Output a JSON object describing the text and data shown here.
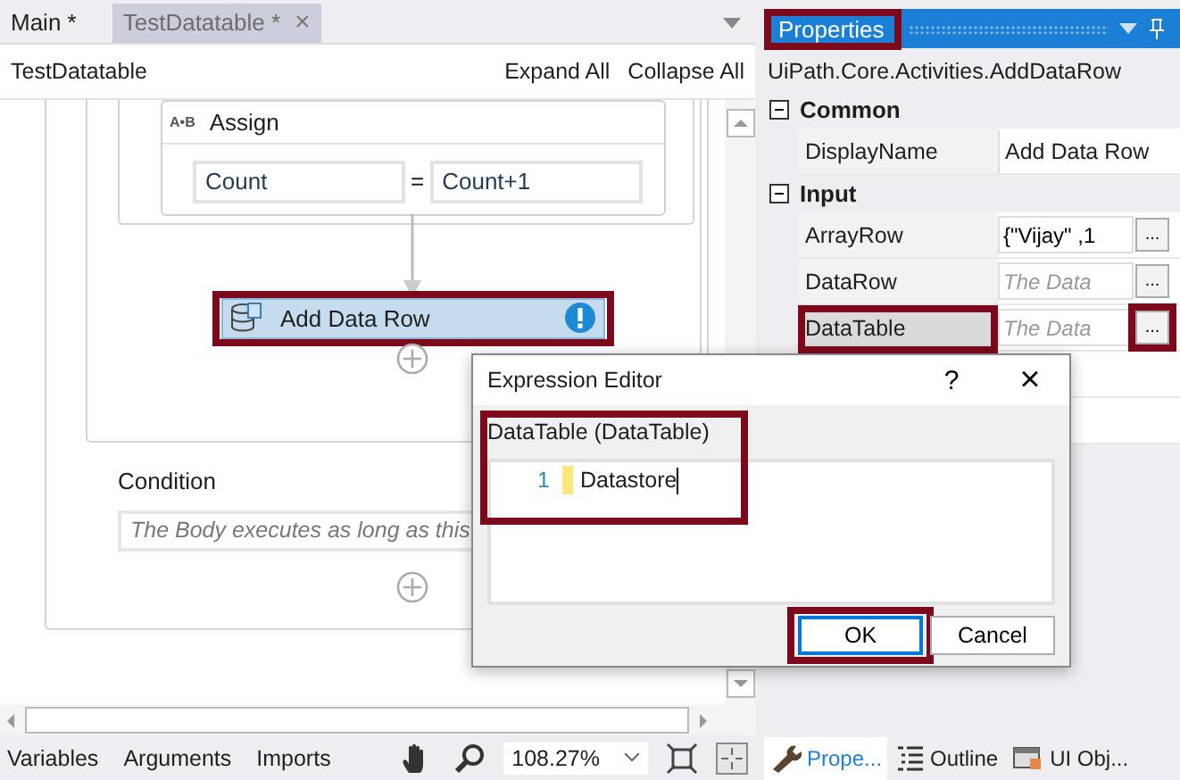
{
  "designer": {
    "tabs": [
      {
        "label": "Main *",
        "selected": false
      },
      {
        "label": "TestDatatable *",
        "selected": true,
        "close": "×"
      }
    ],
    "breadcrumb": "TestDatatable",
    "header_links": [
      "Expand All",
      "Collapse All"
    ],
    "assign": {
      "icon_label": "A•B",
      "title": "Assign",
      "to": "Count",
      "equals": "=",
      "value": "Count+1"
    },
    "activity": {
      "title": "Add Data Row",
      "highlighted": true,
      "warning": true
    },
    "condition": {
      "label": "Condition",
      "placeholder": "The Body executes as long as this"
    },
    "bottom_tabs": [
      "Variables",
      "Arguments",
      "Imports"
    ],
    "zoom": "108.27%"
  },
  "properties": {
    "title": "Properties",
    "highlighted": true,
    "type_name": "UiPath.Core.Activities.AddDataRow",
    "groups": [
      {
        "name": "Common",
        "expanded": true,
        "rows": [
          {
            "kind": "text",
            "name": "DisplayName",
            "value": "Add Data Row",
            "selected": false,
            "highlighted": false
          }
        ]
      },
      {
        "name": "Input",
        "expanded": true,
        "rows": [
          {
            "kind": "expression",
            "name": "ArrayRow",
            "value": "{\"Vijay\" ,1",
            "button": "...",
            "selected": false,
            "highlighted": false
          },
          {
            "kind": "expression",
            "name": "DataRow",
            "placeholder": "The Data",
            "button": "...",
            "selected": false,
            "highlighted": false
          },
          {
            "kind": "expression",
            "name": "DataTable",
            "placeholder": "The Data",
            "button": "...",
            "selected": true,
            "highlighted": true
          }
        ]
      }
    ],
    "panel_tabs": [
      {
        "label": "Prope...",
        "selected": true
      },
      {
        "label": "Outline",
        "selected": false
      },
      {
        "label": "UI Obj...",
        "selected": false
      }
    ]
  },
  "dialog": {
    "title": "Expression Editor",
    "help": "?",
    "close": "×",
    "label": "DataTable (DataTable)",
    "highlighted": true,
    "lines": [
      {
        "number": "1",
        "text": "Datastore"
      }
    ],
    "buttons": [
      {
        "label": "OK",
        "default": true,
        "highlighted": true
      },
      {
        "label": "Cancel",
        "default": false,
        "highlighted": false
      }
    ]
  }
}
